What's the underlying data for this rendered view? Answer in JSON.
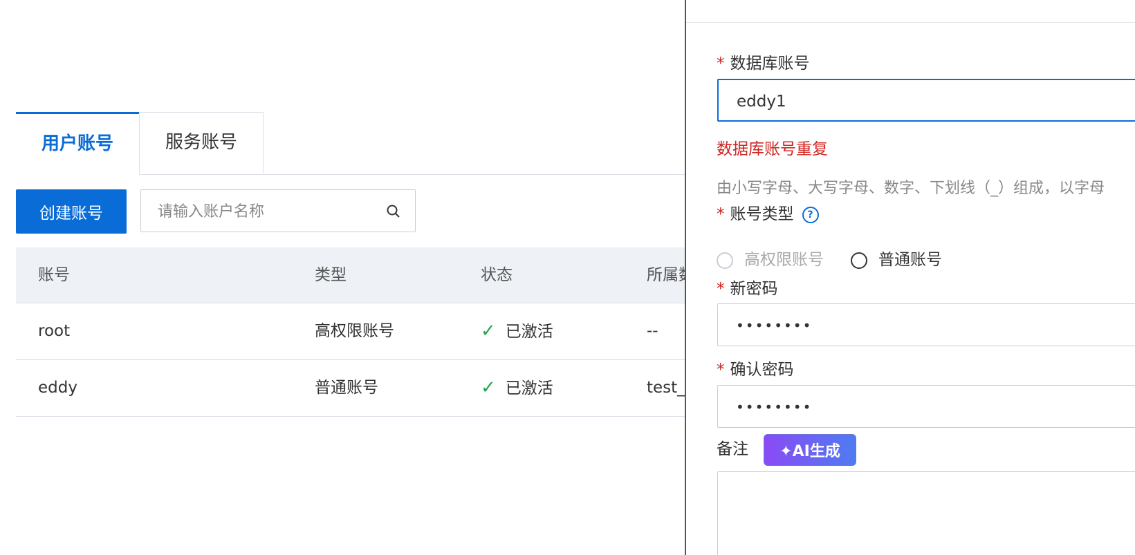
{
  "tabs": {
    "user_accounts": "用户账号",
    "service_accounts": "服务账号"
  },
  "toolbar": {
    "create_label": "创建账号",
    "search_placeholder": "请输入账户名称"
  },
  "table": {
    "headers": [
      "账号",
      "类型",
      "状态",
      "所属数"
    ],
    "rows": [
      {
        "account": "root",
        "type": "高权限账号",
        "status": "已激活",
        "db": "--"
      },
      {
        "account": "eddy",
        "type": "普通账号",
        "status": "已激活",
        "db": "test_d"
      }
    ]
  },
  "form": {
    "db_account_label": "数据库账号",
    "db_account_value": "eddy1",
    "error": "数据库账号重复",
    "hint": "由小写字母、大写字母、数字、下划线（_）组成，以字母",
    "account_type_label": "账号类型",
    "help_glyph": "?",
    "type_options": {
      "high": "高权限账号",
      "normal": "普通账号"
    },
    "new_password_label": "新密码",
    "new_password_value": "••••••••",
    "confirm_password_label": "确认密码",
    "confirm_password_value": "••••••••",
    "note_label": "备注",
    "ai_button_label": "✦AI生成",
    "required_mark": "*"
  },
  "colors": {
    "primary": "#0a6cd6",
    "error": "#d0241f",
    "success": "#22a84a"
  }
}
